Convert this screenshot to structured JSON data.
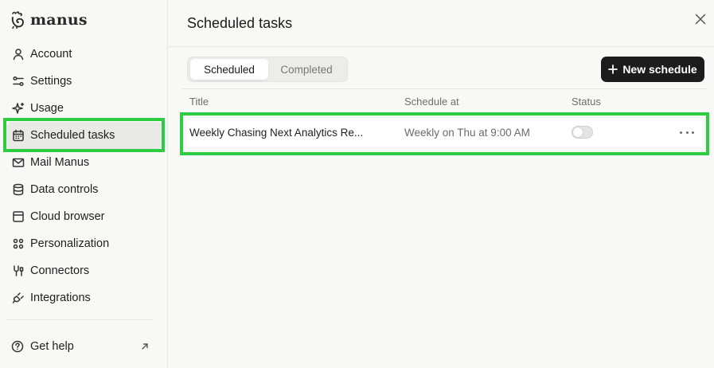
{
  "brand": {
    "name": "manus"
  },
  "sidebar": {
    "items": [
      {
        "label": "Account",
        "icon": "user-icon"
      },
      {
        "label": "Settings",
        "icon": "sliders-icon"
      },
      {
        "label": "Usage",
        "icon": "sparkle-icon"
      },
      {
        "label": "Scheduled tasks",
        "icon": "calendar-icon",
        "active": true
      },
      {
        "label": "Mail Manus",
        "icon": "mail-icon"
      },
      {
        "label": "Data controls",
        "icon": "database-icon"
      },
      {
        "label": "Cloud browser",
        "icon": "browser-icon"
      },
      {
        "label": "Personalization",
        "icon": "grid-icon"
      },
      {
        "label": "Connectors",
        "icon": "connector-icon"
      },
      {
        "label": "Integrations",
        "icon": "plug-icon"
      }
    ],
    "help_label": "Get help"
  },
  "main": {
    "title": "Scheduled tasks",
    "tabs": [
      {
        "label": "Scheduled",
        "active": true
      },
      {
        "label": "Completed",
        "active": false
      }
    ],
    "new_button_label": "New schedule",
    "table": {
      "headers": {
        "title": "Title",
        "schedule": "Schedule at",
        "status": "Status"
      },
      "rows": [
        {
          "title": "Weekly Chasing Next Analytics Re...",
          "schedule": "Weekly on Thu at 9:00 AM",
          "enabled": false
        }
      ]
    }
  },
  "colors": {
    "highlight": "#2ecc40",
    "button_bg": "#1c1c1c",
    "background": "#f8f8f7"
  }
}
